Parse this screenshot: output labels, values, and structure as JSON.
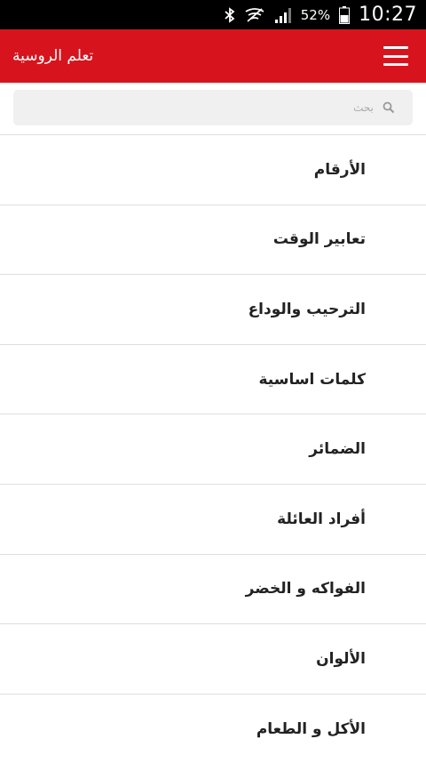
{
  "status_bar": {
    "battery_percent": "52%",
    "time": "10:27",
    "icons": [
      "bluetooth-icon",
      "no-signal-icon",
      "signal-icon",
      "battery-icon"
    ]
  },
  "app_bar": {
    "title": "تعلم الروسية",
    "menu_icon": "hamburger-menu-icon",
    "color": "#d7141d"
  },
  "search": {
    "placeholder": "بحث",
    "icon": "search-icon"
  },
  "categories": [
    {
      "label": "الأرقام"
    },
    {
      "label": "تعابير الوقت"
    },
    {
      "label": "الترحيب والوداع"
    },
    {
      "label": "كلمات اساسية"
    },
    {
      "label": "الضمائر"
    },
    {
      "label": "أفراد العائلة"
    },
    {
      "label": "الفواكه و الخضر"
    },
    {
      "label": "الألوان"
    },
    {
      "label": "الأكل و الطعام"
    }
  ]
}
